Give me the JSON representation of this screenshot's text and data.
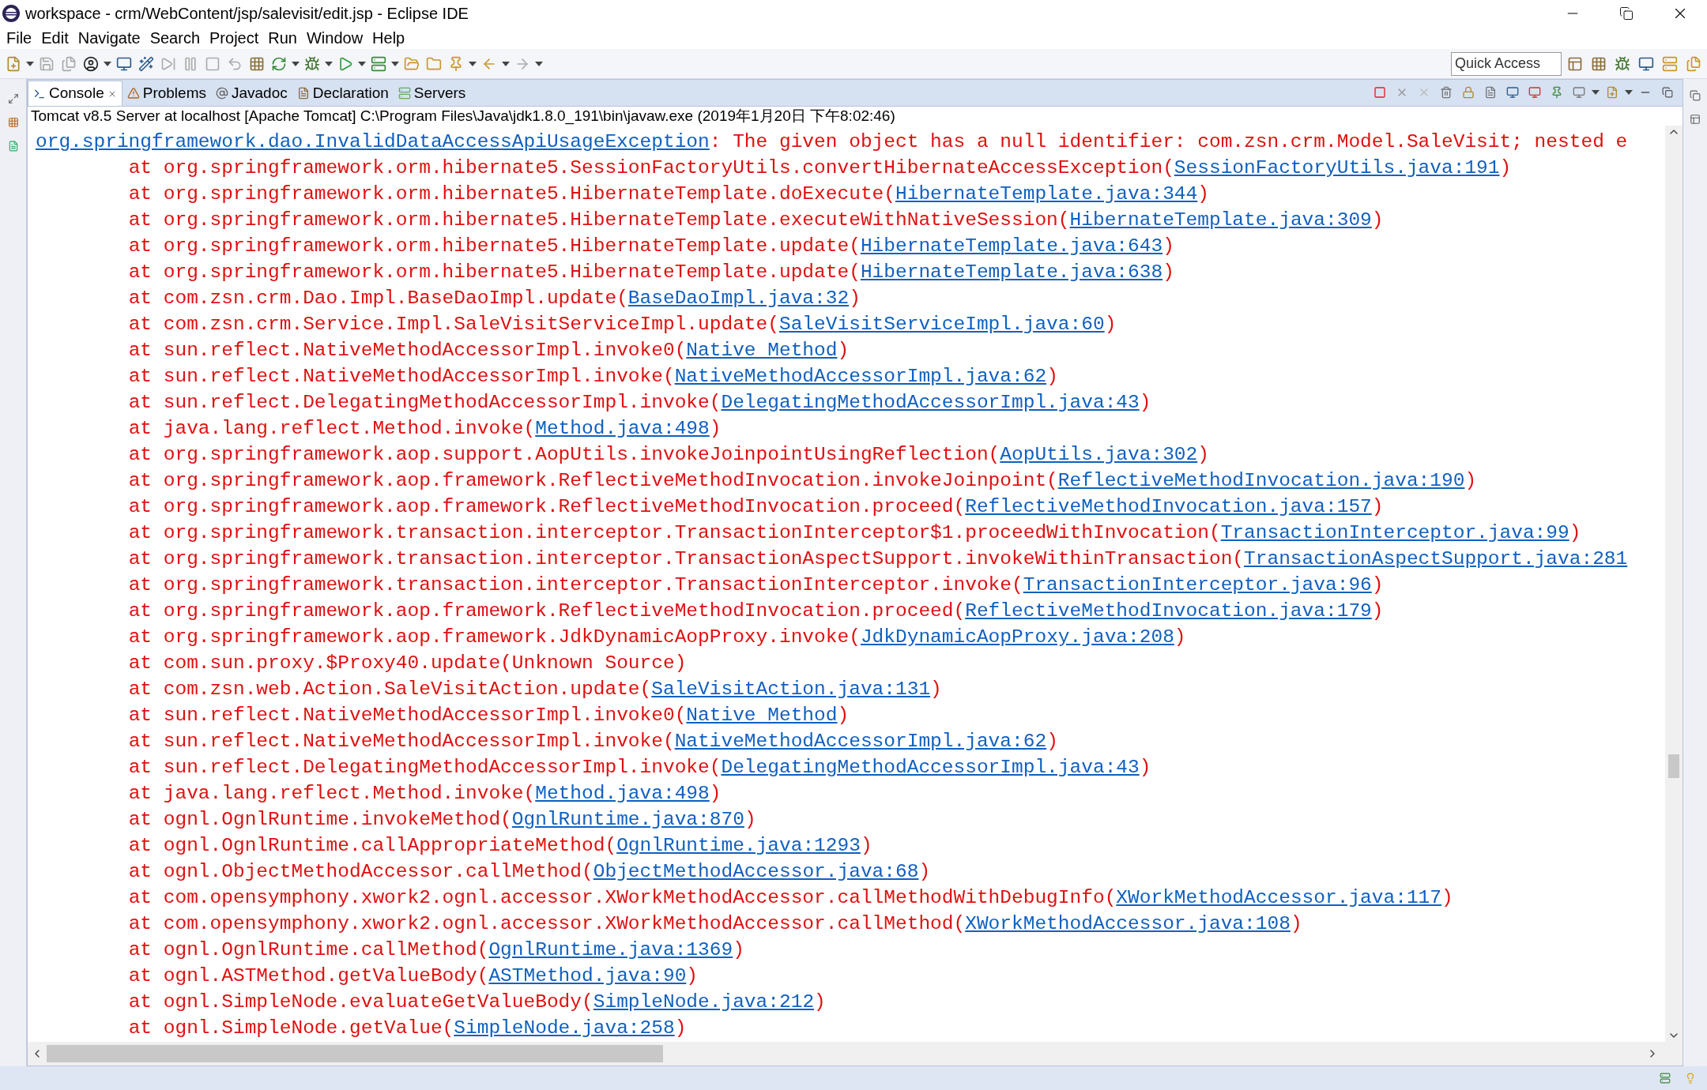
{
  "window": {
    "title": "workspace - crm/WebContent/jsp/salevisit/edit.jsp - Eclipse IDE"
  },
  "menu": [
    "File",
    "Edit",
    "Navigate",
    "Search",
    "Project",
    "Run",
    "Window",
    "Help"
  ],
  "quick_access": {
    "placeholder": "Quick Access"
  },
  "tabs": [
    {
      "label": "Console",
      "selected": true
    },
    {
      "label": "Problems",
      "selected": false
    },
    {
      "label": "Javadoc",
      "selected": false
    },
    {
      "label": "Declaration",
      "selected": false
    },
    {
      "label": "Servers",
      "selected": false
    }
  ],
  "console": {
    "description": "Tomcat v8.5 Server at localhost [Apache Tomcat] C:\\Program Files\\Java\\jdk1.8.0_191\\bin\\javaw.exe (2019年1月20日 下午8:02:46)",
    "lines": [
      {
        "link": "org.springframework.dao.InvalidDataAccessApiUsageException",
        "post": ": The given object has a null identifier: com.zsn.crm.Model.SaleVisit; nested e"
      },
      {
        "pre": "\tat org.springframework.orm.hibernate5.SessionFactoryUtils.convertHibernateAccessException(",
        "link": "SessionFactoryUtils.java:191",
        "post": ")"
      },
      {
        "pre": "\tat org.springframework.orm.hibernate5.HibernateTemplate.doExecute(",
        "link": "HibernateTemplate.java:344",
        "post": ")"
      },
      {
        "pre": "\tat org.springframework.orm.hibernate5.HibernateTemplate.executeWithNativeSession(",
        "link": "HibernateTemplate.java:309",
        "post": ")"
      },
      {
        "pre": "\tat org.springframework.orm.hibernate5.HibernateTemplate.update(",
        "link": "HibernateTemplate.java:643",
        "post": ")"
      },
      {
        "pre": "\tat org.springframework.orm.hibernate5.HibernateTemplate.update(",
        "link": "HibernateTemplate.java:638",
        "post": ")"
      },
      {
        "pre": "\tat com.zsn.crm.Dao.Impl.BaseDaoImpl.update(",
        "link": "BaseDaoImpl.java:32",
        "post": ")"
      },
      {
        "pre": "\tat com.zsn.crm.Service.Impl.SaleVisitServiceImpl.update(",
        "link": "SaleVisitServiceImpl.java:60",
        "post": ")"
      },
      {
        "pre": "\tat sun.reflect.NativeMethodAccessorImpl.invoke0(",
        "link": "Native Method",
        "post": ")"
      },
      {
        "pre": "\tat sun.reflect.NativeMethodAccessorImpl.invoke(",
        "link": "NativeMethodAccessorImpl.java:62",
        "post": ")"
      },
      {
        "pre": "\tat sun.reflect.DelegatingMethodAccessorImpl.invoke(",
        "link": "DelegatingMethodAccessorImpl.java:43",
        "post": ")"
      },
      {
        "pre": "\tat java.lang.reflect.Method.invoke(",
        "link": "Method.java:498",
        "post": ")"
      },
      {
        "pre": "\tat org.springframework.aop.support.AopUtils.invokeJoinpointUsingReflection(",
        "link": "AopUtils.java:302",
        "post": ")"
      },
      {
        "pre": "\tat org.springframework.aop.framework.ReflectiveMethodInvocation.invokeJoinpoint(",
        "link": "ReflectiveMethodInvocation.java:190",
        "post": ")"
      },
      {
        "pre": "\tat org.springframework.aop.framework.ReflectiveMethodInvocation.proceed(",
        "link": "ReflectiveMethodInvocation.java:157",
        "post": ")"
      },
      {
        "pre": "\tat org.springframework.transaction.interceptor.TransactionInterceptor$1.proceedWithInvocation(",
        "link": "TransactionInterceptor.java:99",
        "post": ")"
      },
      {
        "pre": "\tat org.springframework.transaction.interceptor.TransactionAspectSupport.invokeWithinTransaction(",
        "link": "TransactionAspectSupport.java:281"
      },
      {
        "pre": "\tat org.springframework.transaction.interceptor.TransactionInterceptor.invoke(",
        "link": "TransactionInterceptor.java:96",
        "post": ")"
      },
      {
        "pre": "\tat org.springframework.aop.framework.ReflectiveMethodInvocation.proceed(",
        "link": "ReflectiveMethodInvocation.java:179",
        "post": ")"
      },
      {
        "pre": "\tat org.springframework.aop.framework.JdkDynamicAopProxy.invoke(",
        "link": "JdkDynamicAopProxy.java:208",
        "post": ")"
      },
      {
        "pre": "\tat com.sun.proxy.$Proxy40.update(Unknown Source)"
      },
      {
        "pre": "\tat com.zsn.web.Action.SaleVisitAction.update(",
        "link": "SaleVisitAction.java:131",
        "post": ")"
      },
      {
        "pre": "\tat sun.reflect.NativeMethodAccessorImpl.invoke0(",
        "link": "Native Method",
        "post": ")"
      },
      {
        "pre": "\tat sun.reflect.NativeMethodAccessorImpl.invoke(",
        "link": "NativeMethodAccessorImpl.java:62",
        "post": ")"
      },
      {
        "pre": "\tat sun.reflect.DelegatingMethodAccessorImpl.invoke(",
        "link": "DelegatingMethodAccessorImpl.java:43",
        "post": ")"
      },
      {
        "pre": "\tat java.lang.reflect.Method.invoke(",
        "link": "Method.java:498",
        "post": ")"
      },
      {
        "pre": "\tat ognl.OgnlRuntime.invokeMethod(",
        "link": "OgnlRuntime.java:870",
        "post": ")"
      },
      {
        "pre": "\tat ognl.OgnlRuntime.callAppropriateMethod(",
        "link": "OgnlRuntime.java:1293",
        "post": ")"
      },
      {
        "pre": "\tat ognl.ObjectMethodAccessor.callMethod(",
        "link": "ObjectMethodAccessor.java:68",
        "post": ")"
      },
      {
        "pre": "\tat com.opensymphony.xwork2.ognl.accessor.XWorkMethodAccessor.callMethodWithDebugInfo(",
        "link": "XWorkMethodAccessor.java:117",
        "post": ")"
      },
      {
        "pre": "\tat com.opensymphony.xwork2.ognl.accessor.XWorkMethodAccessor.callMethod(",
        "link": "XWorkMethodAccessor.java:108",
        "post": ")"
      },
      {
        "pre": "\tat ognl.OgnlRuntime.callMethod(",
        "link": "OgnlRuntime.java:1369",
        "post": ")"
      },
      {
        "pre": "\tat ognl.ASTMethod.getValueBody(",
        "link": "ASTMethod.java:90",
        "post": ")"
      },
      {
        "pre": "\tat ognl.SimpleNode.evaluateGetValueBody(",
        "link": "SimpleNode.java:212",
        "post": ")"
      },
      {
        "pre": "\tat ognl.SimpleNode.getValue(",
        "link": "SimpleNode.java:258",
        "post": ")"
      }
    ]
  }
}
